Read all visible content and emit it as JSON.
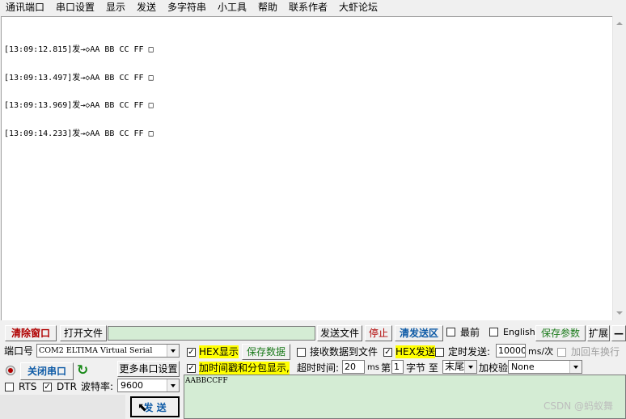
{
  "menu": [
    "通讯端口",
    "串口设置",
    "显示",
    "发送",
    "多字符串",
    "小工具",
    "帮助",
    "联系作者",
    "大虾论坛"
  ],
  "log_lines": [
    "[13:09:12.815]发→◇AA BB CC FF □",
    "[13:09:13.497]发→◇AA BB CC FF □",
    "[13:09:13.969]发→◇AA BB CC FF □",
    "[13:09:14.233]发→◇AA BB CC FF □"
  ],
  "toolbar": {
    "clear_window": "清除窗口",
    "open_file": "打开文件",
    "send_file": "发送文件",
    "stop": "停止",
    "clear_send": "清发送区",
    "topmost": "最前",
    "english": "English",
    "save_params": "保存参数",
    "expand": "扩展",
    "collapse": "—"
  },
  "port": {
    "port_label": "端口号",
    "port_value": "COM2 ELTIMA Virtual Serial",
    "close_port": "关闭串口",
    "more_settings": "更多串口设置",
    "rts": "RTS",
    "dtr": "DTR",
    "baud_label": "波特率:",
    "baud_value": "9600",
    "send": "发 送"
  },
  "options": {
    "hex_display": "HEX显示",
    "save_data": "保存数据",
    "receive_to_file": "接收数据到文件",
    "hex_send": "HEX发送",
    "timed_send": "定时发送:",
    "interval": "10000",
    "interval_unit": "ms/次",
    "add_crlf": "加回车换行",
    "timestamp_packet": "加时间戳和分包显示,",
    "timeout_label": "超时时间:",
    "timeout_value": "20",
    "timeout_unit": "ms",
    "byte_prefix": "第",
    "byte_index": "1",
    "byte_label": "字节 至",
    "end_value": "末尾",
    "checksum_label": "加校验",
    "checksum_value": "None"
  },
  "send_text": "AABBCCFF",
  "watermark": "CSDN @蚂蚁舞"
}
